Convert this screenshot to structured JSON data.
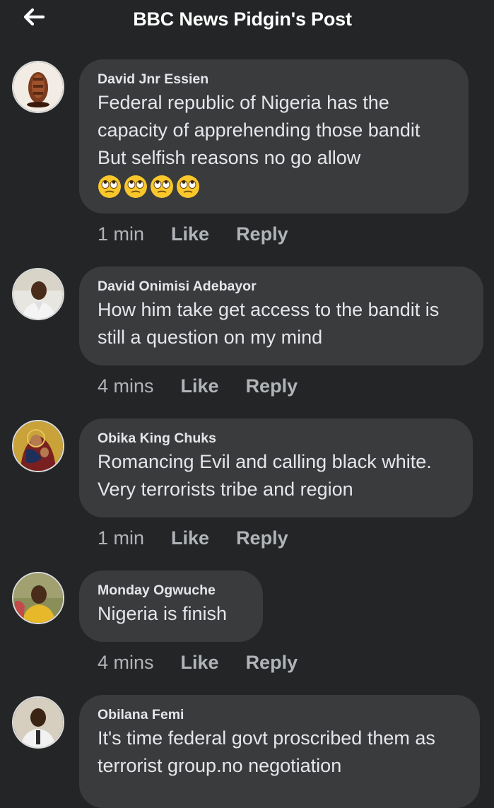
{
  "header": {
    "title": "BBC News Pidgin's Post",
    "back_icon": "arrow-left-icon"
  },
  "comments": [
    {
      "author": "David Jnr Essien",
      "lines": [
        "Federal republic of Nigeria  has the",
        "capacity of apprehending those bandit",
        "But selfish reasons no go allow"
      ],
      "emojis": [
        "face-with-rolling-eyes",
        "face-with-rolling-eyes",
        "face-with-rolling-eyes",
        "face-with-rolling-eyes"
      ],
      "time": "1 min",
      "like": "Like",
      "reply": "Reply"
    },
    {
      "author": "David Onimisi Adebayor",
      "lines": [
        "How him take get access to the bandit is",
        "still a question on my mind"
      ],
      "time": "4 mins",
      "like": "Like",
      "reply": "Reply"
    },
    {
      "author": "Obika King Chuks",
      "lines": [
        "Romancing Evil and calling black white.",
        "Very terrorists tribe and region"
      ],
      "time": "1 min",
      "like": "Like",
      "reply": "Reply"
    },
    {
      "author": "Monday Ogwuche",
      "lines": [
        "Nigeria is finish"
      ],
      "time": "4 mins",
      "like": "Like",
      "reply": "Reply"
    },
    {
      "author": "Obilana Femi",
      "lines": [
        "It's time federal govt proscribed them as",
        "terrorist group.no negotiation"
      ]
    }
  ],
  "colors": {
    "background": "#242526",
    "bubble": "#3a3b3c",
    "text": "#e4e6eb",
    "muted": "#b0b3b8"
  }
}
